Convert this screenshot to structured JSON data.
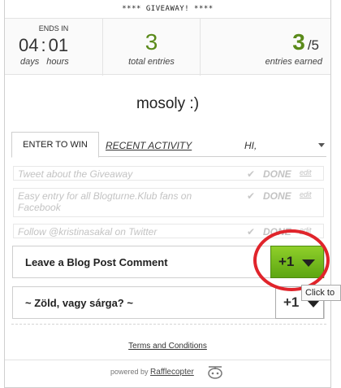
{
  "header": {
    "giveaway_title": "**** GIVEAWAY! ****"
  },
  "stats": {
    "ends_in_label": "ENDS IN",
    "days_value": "04",
    "hours_value": "01",
    "separator": ":",
    "days_label": "days",
    "hours_label": "hours",
    "total_entries_value": "3",
    "total_entries_label": "total entries",
    "entries_earned_value": "3",
    "entries_earned_max": "/5",
    "entries_earned_label": "entries earned"
  },
  "prize": {
    "title": "mosoly :)"
  },
  "tabs": {
    "enter_to_win": "ENTER TO WIN",
    "recent_activity": "RECENT ACTIVITY",
    "user_greeting": "HI,"
  },
  "entries_done": [
    {
      "text": "Tweet about the Giveaway",
      "status": "DONE",
      "edit": "edit"
    },
    {
      "text": "Easy entry for all Blogturne.Klub fans on Facebook",
      "status": "DONE",
      "edit": "edit"
    },
    {
      "text": "Follow @kristinasakal on Twitter",
      "status": "DONE",
      "edit": "edit"
    }
  ],
  "check_glyph": "✔",
  "entries_open": [
    {
      "label": "Leave a Blog Post Comment",
      "button": "+1"
    },
    {
      "label": "~ Zöld, vagy sárga? ~",
      "button": "+1"
    }
  ],
  "tooltip": "Click to",
  "footer": {
    "terms": "Terms and Conditions",
    "powered_by": "powered by",
    "brand": "Rafflecopter"
  },
  "colors": {
    "accent_green": "#5a8a1a",
    "button_green": "#6fb819",
    "annotation_red": "#e0242b"
  }
}
